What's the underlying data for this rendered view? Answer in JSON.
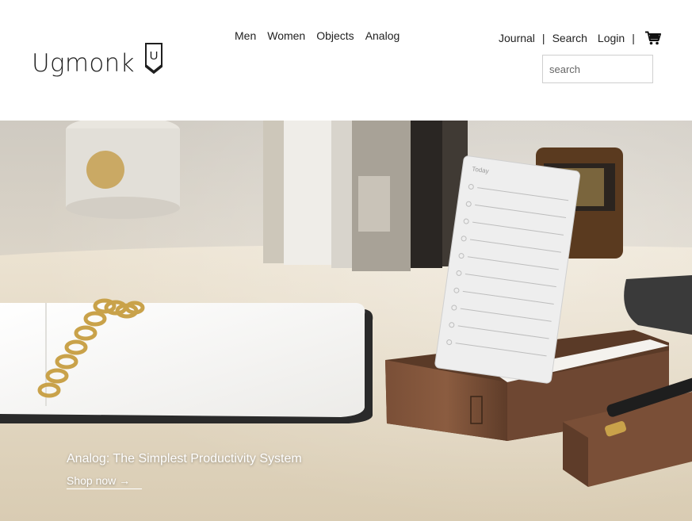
{
  "brand": {
    "name": "Ugmonk",
    "logo_icon": "u-monogram-icon",
    "logo_letter": "U"
  },
  "main_nav": {
    "items": [
      {
        "label": "Men"
      },
      {
        "label": "Women"
      },
      {
        "label": "Objects"
      },
      {
        "label": "Analog"
      }
    ]
  },
  "util_nav": {
    "journal": "Journal",
    "search": "Search",
    "login": "Login",
    "separator": "|",
    "cart_icon": "cart-icon"
  },
  "search": {
    "placeholder": "search",
    "value": ""
  },
  "hero": {
    "title": "Analog: The Simplest Productivity System",
    "cta_label": "Shop now →",
    "card_heading": "Today"
  },
  "colors": {
    "text": "#222222",
    "border": "#cfcfcf",
    "walnut": "#6b4530",
    "brass": "#c9a24a"
  }
}
